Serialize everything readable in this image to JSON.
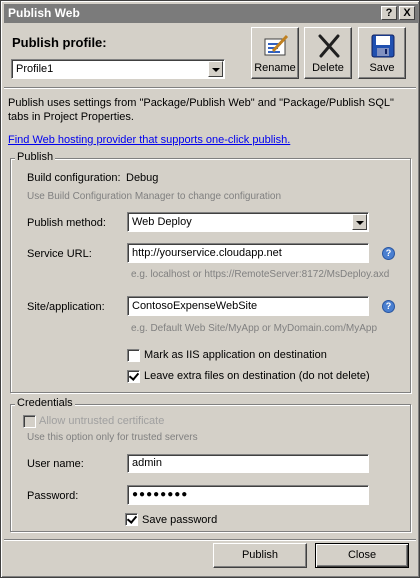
{
  "window": {
    "title": "Publish Web",
    "help_glyph": "?",
    "close_glyph": "X"
  },
  "profile": {
    "label": "Publish profile:",
    "selected": "Profile1",
    "rename_label": "Rename",
    "delete_label": "Delete",
    "save_label": "Save"
  },
  "info": {
    "description": "Publish uses settings from \"Package/Publish Web\" and \"Package/Publish SQL\" tabs in Project Properties.",
    "link": "Find Web hosting provider that supports one-click publish."
  },
  "publish": {
    "group_title": "Publish",
    "build_config_label": "Build configuration:",
    "build_config_value": "Debug",
    "build_config_hint": "Use Build Configuration Manager to change configuration",
    "method_label": "Publish method:",
    "method_value": "Web Deploy",
    "service_url_label": "Service URL:",
    "service_url_value": "http://yourservice.cloudapp.net",
    "service_url_hint": "e.g. localhost or https://RemoteServer:8172/MsDeploy.axd",
    "site_label": "Site/application:",
    "site_value": "ContosoExpenseWebSite",
    "site_hint": "e.g. Default Web Site/MyApp or MyDomain.com/MyApp",
    "mark_iis_label": "Mark as IIS application on destination",
    "mark_iis_checked": false,
    "leave_files_label": "Leave extra files on destination (do not delete)",
    "leave_files_checked": true
  },
  "credentials": {
    "group_title": "Credentials",
    "untrusted_label": "Allow untrusted certificate",
    "untrusted_hint": "Use this option only for trusted servers",
    "username_label": "User name:",
    "username_value": "admin",
    "password_label": "Password:",
    "password_value": "●●●●●●●●",
    "save_password_label": "Save password",
    "save_password_checked": true
  },
  "footer": {
    "publish_label": "Publish",
    "close_label": "Close"
  },
  "colors": {
    "face": "#d4d0c8",
    "titlebar": "#7b7b7b",
    "link": "#0000ee",
    "help": "#4a7fd0"
  }
}
